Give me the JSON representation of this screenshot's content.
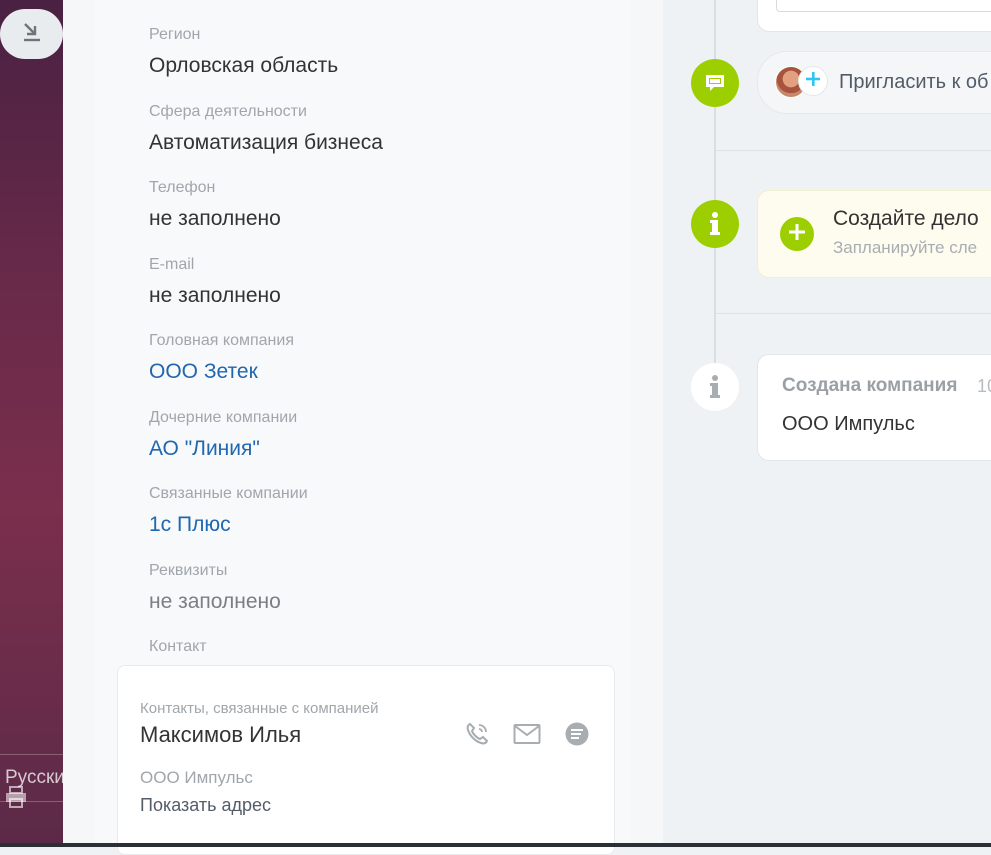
{
  "sidebar": {
    "language_label": "Русский"
  },
  "fields": [
    {
      "label": "Регион",
      "value": "Орловская область",
      "kind": "text"
    },
    {
      "label": "Сфера деятельности",
      "value": "Автоматизация бизнеса",
      "kind": "text"
    },
    {
      "label": "Телефон",
      "value": "не заполнено",
      "kind": "text"
    },
    {
      "label": "E-mail",
      "value": "не заполнено",
      "kind": "text"
    },
    {
      "label": "Головная компания",
      "value": "ООО Зетек",
      "kind": "link"
    },
    {
      "label": "Дочерние компании",
      "value": "АО \"Линия\"",
      "kind": "link"
    },
    {
      "label": "Связанные компании",
      "value": "1с Плюс",
      "kind": "link"
    },
    {
      "label": "Реквизиты",
      "value": "не заполнено",
      "kind": "empty"
    }
  ],
  "contact": {
    "section_label": "Контакт",
    "card_label": "Контакты, связанные с компанией",
    "name": "Максимов Илья",
    "company": "ООО Импульс",
    "address_link": "Показать адрес",
    "icons": [
      "phone-icon",
      "mail-icon",
      "chat-icon"
    ]
  },
  "timeline": {
    "invite_text": "Пригласить к об",
    "todo_title": "Создайте дело",
    "todo_subtitle": "Запланируйте сле",
    "created_title": "Создана компания",
    "created_date": "10",
    "created_name": "ООО Импульс"
  },
  "colors": {
    "accent_green": "#9dcf00",
    "link_blue": "#2067b0",
    "sidebar_purple": "#6a2a4a"
  }
}
